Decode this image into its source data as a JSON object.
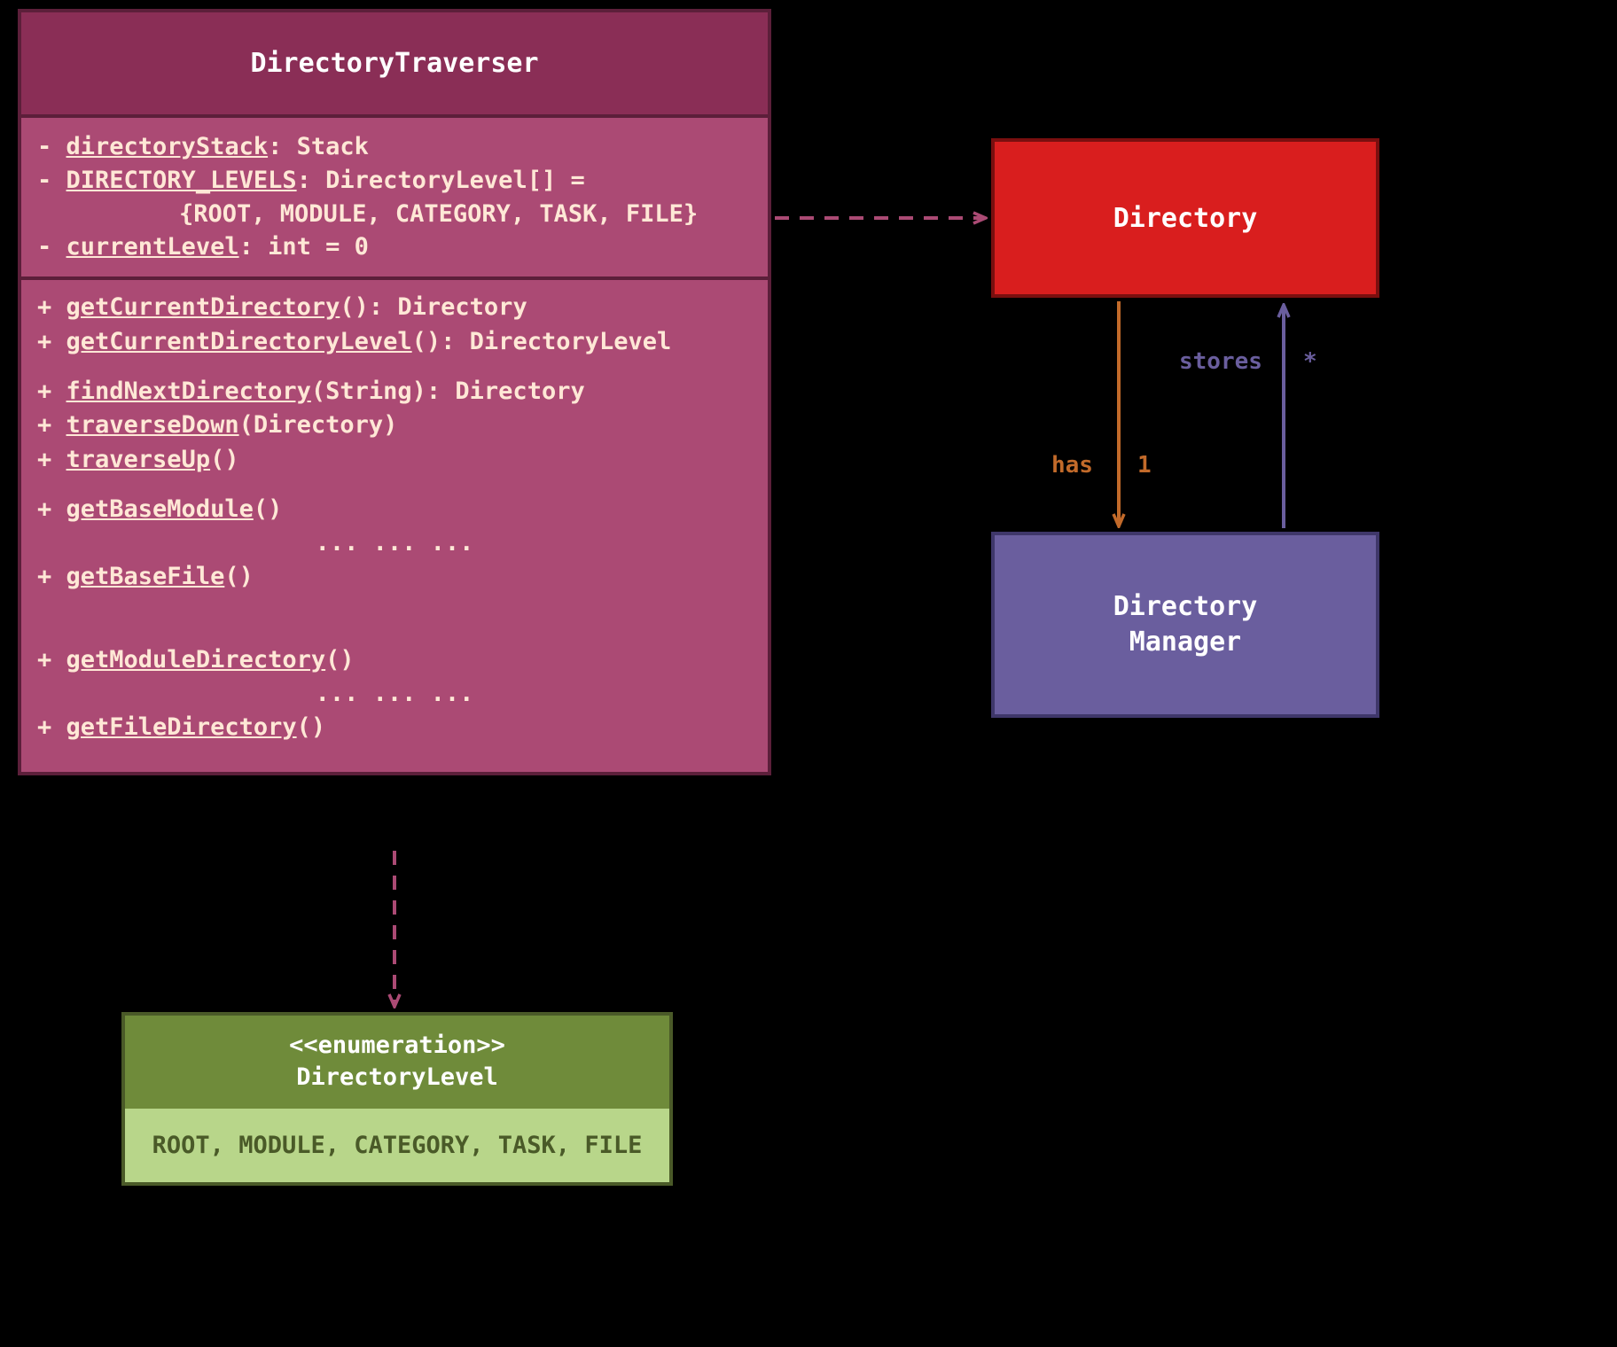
{
  "directoryTraverser": {
    "name": "DirectoryTraverser",
    "attrs": {
      "a1_pre": "- ",
      "a1_name": "directoryStack",
      "a1_post": ": Stack",
      "a2_pre": "- ",
      "a2_name": "DIRECTORY_LEVELS",
      "a2_post": ": DirectoryLevel[] =",
      "a2_val": "{ROOT, MODULE, CATEGORY, TASK, FILE}",
      "a3_pre": "- ",
      "a3_name": "currentLevel",
      "a3_post": ": int = 0"
    },
    "methods": {
      "m1_pre": "+ ",
      "m1_name": "getCurrentDirectory",
      "m1_post": "(): Directory",
      "m2_pre": "+ ",
      "m2_name": "getCurrentDirectoryLevel",
      "m2_post": "(): DirectoryLevel",
      "m3_pre": "+ ",
      "m3_name": "findNextDirectory",
      "m3_post": "(String): Directory",
      "m4_pre": "+ ",
      "m4_name": "traverseDown",
      "m4_post": "(Directory)",
      "m5_pre": "+ ",
      "m5_name": "traverseUp",
      "m5_post": "()",
      "m6_pre": "+ ",
      "m6_name": "getBaseModule",
      "m6_post": "()",
      "ellipsis1": "... ... ...",
      "m7_pre": "+ ",
      "m7_name": "getBaseFile",
      "m7_post": "()",
      "m8_pre": "+ ",
      "m8_name": "getModuleDirectory",
      "m8_post": "()",
      "ellipsis2": "... ... ...",
      "m9_pre": "+ ",
      "m9_name": "getFileDirectory",
      "m9_post": "()"
    }
  },
  "directory": {
    "name": "Directory"
  },
  "directoryManager": {
    "name_line1": "Directory",
    "name_line2": "Manager"
  },
  "directoryLevel": {
    "stereotype": "<<enumeration>>",
    "name": "DirectoryLevel",
    "values": "ROOT, MODULE, CATEGORY, TASK, FILE"
  },
  "relations": {
    "has_label": "has",
    "has_mult": "1",
    "stores_label": "stores",
    "stores_mult": "*"
  }
}
